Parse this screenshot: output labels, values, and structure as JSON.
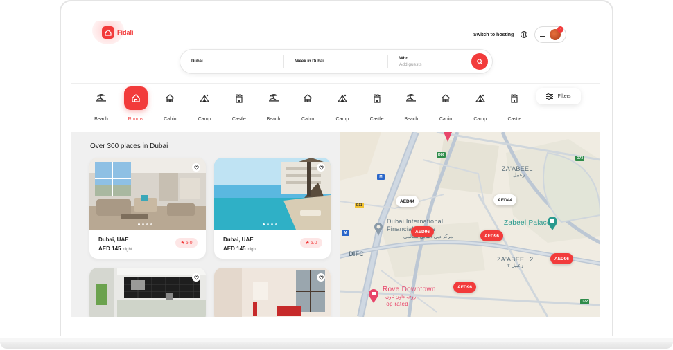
{
  "app": {
    "logo_text": "Fidali",
    "accent": "#f23b3b"
  },
  "header": {
    "switch_label": "Switch to hosting",
    "notification_count": "3"
  },
  "search": {
    "location_value": "Dubai",
    "dates_value": "Week in Dubai",
    "guests_label": "Who",
    "guests_placeholder": "Add guests"
  },
  "categories": [
    {
      "label": "Beach",
      "icon": "beach-icon"
    },
    {
      "label": "Rooms",
      "icon": "home-icon",
      "active": true
    },
    {
      "label": "Cabin",
      "icon": "cabin-icon"
    },
    {
      "label": "Camp",
      "icon": "camp-icon"
    },
    {
      "label": "Castle",
      "icon": "castle-icon"
    },
    {
      "label": "Beach",
      "icon": "beach-icon"
    },
    {
      "label": "Cabin",
      "icon": "cabin-icon"
    },
    {
      "label": "Camp",
      "icon": "camp-icon"
    },
    {
      "label": "Castle",
      "icon": "castle-icon"
    },
    {
      "label": "Beach",
      "icon": "beach-icon"
    },
    {
      "label": "Cabin",
      "icon": "cabin-icon"
    },
    {
      "label": "Camp",
      "icon": "camp-icon"
    },
    {
      "label": "Castle",
      "icon": "castle-icon"
    }
  ],
  "filters_label": "Filters",
  "results": {
    "title": "Over 300 places in Dubai",
    "cards": [
      {
        "location": "Dubai, UAE",
        "price": "AED 145",
        "unit": "night",
        "rating": "5.0"
      },
      {
        "location": "Dubai, UAE",
        "price": "AED 145",
        "unit": "night",
        "rating": "5.0"
      }
    ]
  },
  "map": {
    "pins": [
      {
        "label": "AED44",
        "style": "white"
      },
      {
        "label": "AED44",
        "style": "white"
      },
      {
        "label": "AED96",
        "style": "red"
      },
      {
        "label": "AED96",
        "style": "red"
      },
      {
        "label": "AED96",
        "style": "red"
      },
      {
        "label": "AED96",
        "style": "red"
      }
    ],
    "labels": {
      "difc_center": "Dubai International Financial Centre",
      "difc_center_ar": "مركز دبي المالي العالمي",
      "difc": "DIFC",
      "zabeel_palace": "Zabeel Palace",
      "zaabeel": "ZA'ABEEL",
      "zaabeel_ar": "زعبيل",
      "zaabeel2": "ZA'ABEEL 2",
      "zaabeel2_ar": "زعبيل ٢",
      "rove": "Rove Downtown",
      "rove_ar": "روڤ داون تاون",
      "top_rated": "Top rated"
    },
    "road_tags": [
      "D86",
      "D73",
      "E11",
      "D72",
      "M"
    ]
  }
}
